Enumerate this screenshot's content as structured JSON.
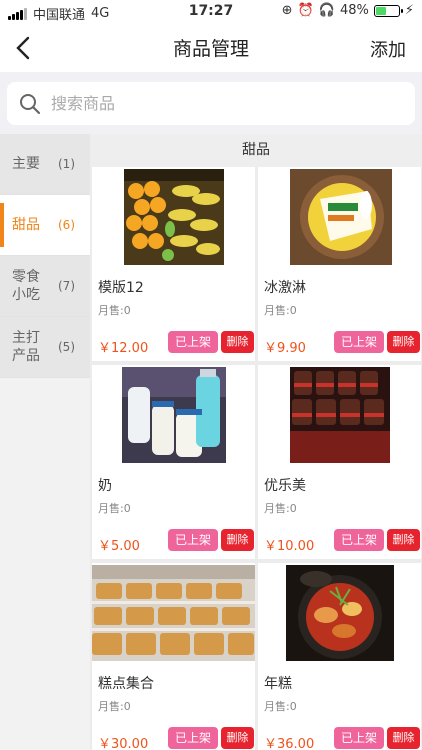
{
  "status_bar": {
    "carrier": "中国联通",
    "network": "4G",
    "time": "17:27",
    "battery": "48%",
    "battery_level": 0.48
  },
  "nav": {
    "title": "商品管理",
    "add_label": "添加"
  },
  "search": {
    "placeholder": "搜索商品"
  },
  "sidebar": {
    "items": [
      {
        "name": "主要",
        "count": "(1)"
      },
      {
        "name": "甜品",
        "count": "(6)"
      },
      {
        "name": "零食小吃",
        "count": "(7)"
      },
      {
        "name": "主打产品",
        "count": "(5)"
      }
    ],
    "active_index": 1
  },
  "content": {
    "category_title": "甜品",
    "on_shelf_label": "已上架",
    "delete_label": "删除",
    "products": [
      {
        "name": "模版12",
        "sold": "月售:0",
        "price": "￥12.00"
      },
      {
        "name": "冰激淋",
        "sold": "月售:0",
        "price": "￥9.90"
      },
      {
        "name": "奶",
        "sold": "月售:0",
        "price": "￥5.00"
      },
      {
        "name": "优乐美",
        "sold": "月售:0",
        "price": "￥10.00"
      },
      {
        "name": "糕点集合",
        "sold": "月售:0",
        "price": "￥30.00"
      },
      {
        "name": "年糕",
        "sold": "月售:0",
        "price": "￥36.00"
      }
    ]
  },
  "colors": {
    "accent": "#f08519",
    "price": "#f0521c",
    "on_shelf": "#f0649c",
    "delete": "#e6232e"
  }
}
